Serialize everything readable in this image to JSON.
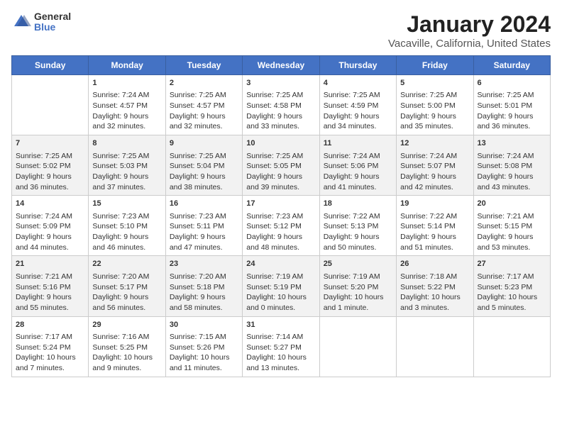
{
  "logo": {
    "general": "General",
    "blue": "Blue"
  },
  "title": "January 2024",
  "subtitle": "Vacaville, California, United States",
  "days_of_week": [
    "Sunday",
    "Monday",
    "Tuesday",
    "Wednesday",
    "Thursday",
    "Friday",
    "Saturday"
  ],
  "weeks": [
    [
      {
        "day": "",
        "content": ""
      },
      {
        "day": "1",
        "content": "Sunrise: 7:24 AM\nSunset: 4:57 PM\nDaylight: 9 hours\nand 32 minutes."
      },
      {
        "day": "2",
        "content": "Sunrise: 7:25 AM\nSunset: 4:57 PM\nDaylight: 9 hours\nand 32 minutes."
      },
      {
        "day": "3",
        "content": "Sunrise: 7:25 AM\nSunset: 4:58 PM\nDaylight: 9 hours\nand 33 minutes."
      },
      {
        "day": "4",
        "content": "Sunrise: 7:25 AM\nSunset: 4:59 PM\nDaylight: 9 hours\nand 34 minutes."
      },
      {
        "day": "5",
        "content": "Sunrise: 7:25 AM\nSunset: 5:00 PM\nDaylight: 9 hours\nand 35 minutes."
      },
      {
        "day": "6",
        "content": "Sunrise: 7:25 AM\nSunset: 5:01 PM\nDaylight: 9 hours\nand 36 minutes."
      }
    ],
    [
      {
        "day": "7",
        "content": "Sunrise: 7:25 AM\nSunset: 5:02 PM\nDaylight: 9 hours\nand 36 minutes."
      },
      {
        "day": "8",
        "content": "Sunrise: 7:25 AM\nSunset: 5:03 PM\nDaylight: 9 hours\nand 37 minutes."
      },
      {
        "day": "9",
        "content": "Sunrise: 7:25 AM\nSunset: 5:04 PM\nDaylight: 9 hours\nand 38 minutes."
      },
      {
        "day": "10",
        "content": "Sunrise: 7:25 AM\nSunset: 5:05 PM\nDaylight: 9 hours\nand 39 minutes."
      },
      {
        "day": "11",
        "content": "Sunrise: 7:24 AM\nSunset: 5:06 PM\nDaylight: 9 hours\nand 41 minutes."
      },
      {
        "day": "12",
        "content": "Sunrise: 7:24 AM\nSunset: 5:07 PM\nDaylight: 9 hours\nand 42 minutes."
      },
      {
        "day": "13",
        "content": "Sunrise: 7:24 AM\nSunset: 5:08 PM\nDaylight: 9 hours\nand 43 minutes."
      }
    ],
    [
      {
        "day": "14",
        "content": "Sunrise: 7:24 AM\nSunset: 5:09 PM\nDaylight: 9 hours\nand 44 minutes."
      },
      {
        "day": "15",
        "content": "Sunrise: 7:23 AM\nSunset: 5:10 PM\nDaylight: 9 hours\nand 46 minutes."
      },
      {
        "day": "16",
        "content": "Sunrise: 7:23 AM\nSunset: 5:11 PM\nDaylight: 9 hours\nand 47 minutes."
      },
      {
        "day": "17",
        "content": "Sunrise: 7:23 AM\nSunset: 5:12 PM\nDaylight: 9 hours\nand 48 minutes."
      },
      {
        "day": "18",
        "content": "Sunrise: 7:22 AM\nSunset: 5:13 PM\nDaylight: 9 hours\nand 50 minutes."
      },
      {
        "day": "19",
        "content": "Sunrise: 7:22 AM\nSunset: 5:14 PM\nDaylight: 9 hours\nand 51 minutes."
      },
      {
        "day": "20",
        "content": "Sunrise: 7:21 AM\nSunset: 5:15 PM\nDaylight: 9 hours\nand 53 minutes."
      }
    ],
    [
      {
        "day": "21",
        "content": "Sunrise: 7:21 AM\nSunset: 5:16 PM\nDaylight: 9 hours\nand 55 minutes."
      },
      {
        "day": "22",
        "content": "Sunrise: 7:20 AM\nSunset: 5:17 PM\nDaylight: 9 hours\nand 56 minutes."
      },
      {
        "day": "23",
        "content": "Sunrise: 7:20 AM\nSunset: 5:18 PM\nDaylight: 9 hours\nand 58 minutes."
      },
      {
        "day": "24",
        "content": "Sunrise: 7:19 AM\nSunset: 5:19 PM\nDaylight: 10 hours\nand 0 minutes."
      },
      {
        "day": "25",
        "content": "Sunrise: 7:19 AM\nSunset: 5:20 PM\nDaylight: 10 hours\nand 1 minute."
      },
      {
        "day": "26",
        "content": "Sunrise: 7:18 AM\nSunset: 5:22 PM\nDaylight: 10 hours\nand 3 minutes."
      },
      {
        "day": "27",
        "content": "Sunrise: 7:17 AM\nSunset: 5:23 PM\nDaylight: 10 hours\nand 5 minutes."
      }
    ],
    [
      {
        "day": "28",
        "content": "Sunrise: 7:17 AM\nSunset: 5:24 PM\nDaylight: 10 hours\nand 7 minutes."
      },
      {
        "day": "29",
        "content": "Sunrise: 7:16 AM\nSunset: 5:25 PM\nDaylight: 10 hours\nand 9 minutes."
      },
      {
        "day": "30",
        "content": "Sunrise: 7:15 AM\nSunset: 5:26 PM\nDaylight: 10 hours\nand 11 minutes."
      },
      {
        "day": "31",
        "content": "Sunrise: 7:14 AM\nSunset: 5:27 PM\nDaylight: 10 hours\nand 13 minutes."
      },
      {
        "day": "",
        "content": ""
      },
      {
        "day": "",
        "content": ""
      },
      {
        "day": "",
        "content": ""
      }
    ]
  ]
}
